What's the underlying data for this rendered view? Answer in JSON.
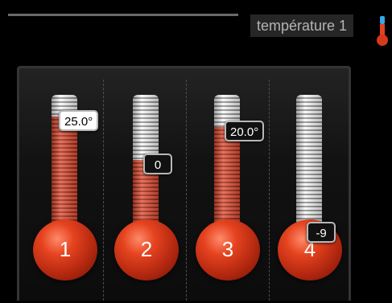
{
  "header": {
    "title": "température 1",
    "icon": "thermometer-icon"
  },
  "thermometers": [
    {
      "number": "1",
      "value_label": "25.0°",
      "level": 0.85,
      "label_style": "light"
    },
    {
      "number": "2",
      "value_label": "0",
      "level": 0.55,
      "label_style": "dark"
    },
    {
      "number": "3",
      "value_label": "20.0°",
      "level": 0.78,
      "label_style": "dark"
    },
    {
      "number": "4",
      "value_label": "-9",
      "level": 0.08,
      "label_style": "dark"
    }
  ],
  "colors": {
    "mercury": "#e4533b",
    "bulb": "#d63a1c",
    "tube": "#f0f0f0",
    "background": "#000000",
    "title_text": "#b4b4b4"
  }
}
